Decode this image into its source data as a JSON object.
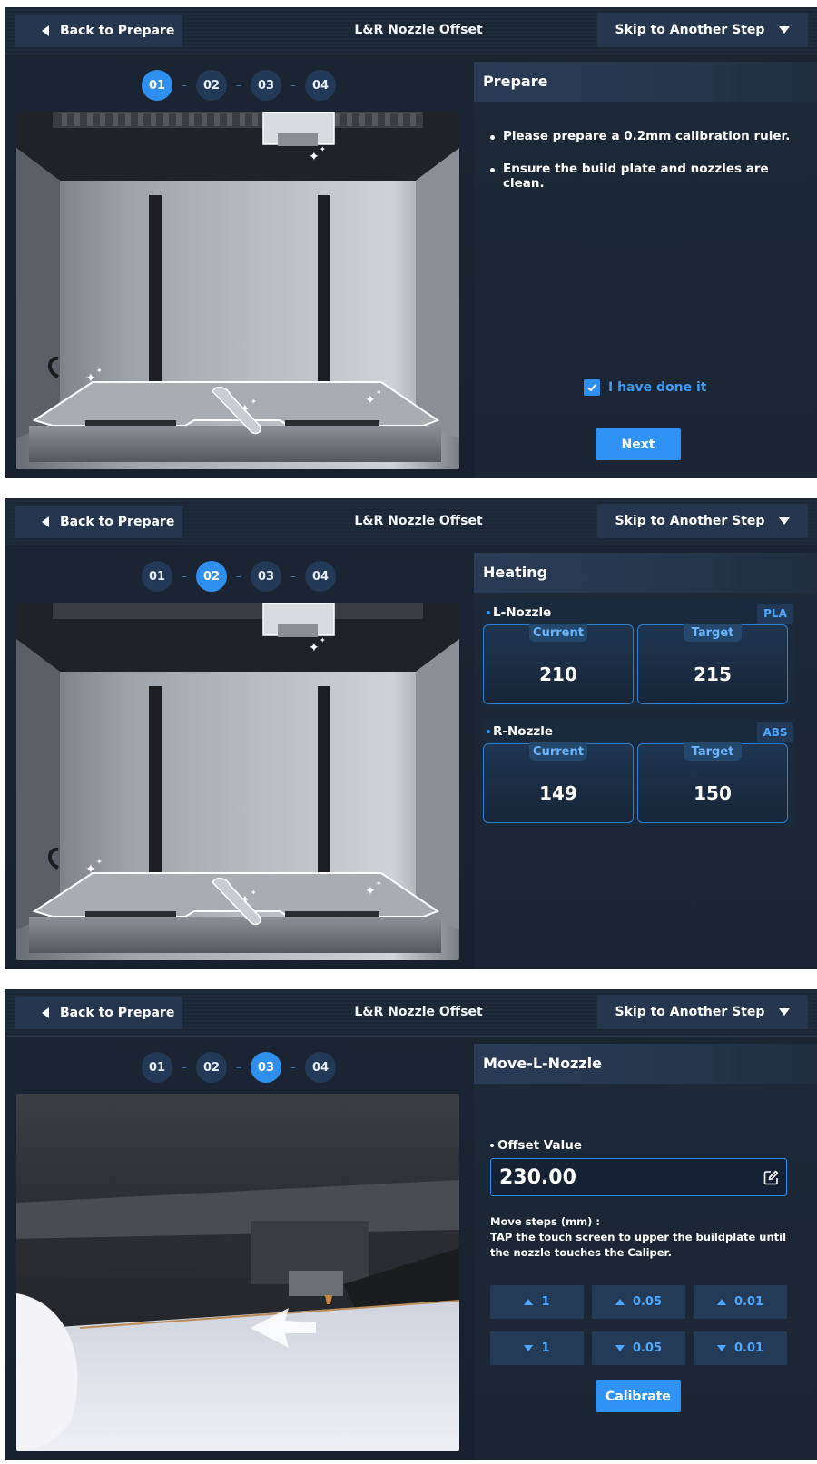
{
  "header": {
    "back_label": "Back to Prepare",
    "title": "L&R Nozzle Offset",
    "skip_label": "Skip to Another Step"
  },
  "steps": [
    "01",
    "02",
    "03",
    "04"
  ],
  "screens": [
    {
      "active_step": "01",
      "panel_title": "Prepare",
      "bullets": [
        "Please prepare a 0.2mm calibration ruler.",
        "Ensure the build plate and nozzles are clean."
      ],
      "checkbox_label": "I have done it",
      "checkbox_checked": true,
      "next_label": "Next"
    },
    {
      "active_step": "02",
      "panel_title": "Heating",
      "nozzles": [
        {
          "name": "L-Nozzle",
          "material": "PLA",
          "current_label": "Current",
          "current": "210",
          "target_label": "Target",
          "target": "215"
        },
        {
          "name": "R-Nozzle",
          "material": "ABS",
          "current_label": "Current",
          "current": "149",
          "target_label": "Target",
          "target": "150"
        }
      ]
    },
    {
      "active_step": "03",
      "panel_title": "Move-L-Nozzle",
      "offset_label": "Offset Value",
      "offset_value": "230.00",
      "move_steps_title": "Move steps (mm) :",
      "move_steps_hint": "TAP the touch screen to upper the buildplate until the nozzle touches the Caliper.",
      "up_buttons": [
        "1",
        "0.05",
        "0.01"
      ],
      "down_buttons": [
        "1",
        "0.05",
        "0.01"
      ],
      "calibrate_label": "Calibrate"
    }
  ],
  "icons": {
    "back": "caret-left-icon",
    "skip": "caret-down-icon",
    "check": "check-icon",
    "edit": "edit-icon",
    "up": "caret-up-icon",
    "down": "caret-down-icon"
  },
  "colors": {
    "accent": "#2f8fef",
    "background": "#1b2533",
    "button": "#24374f",
    "link": "#3d9cf5"
  }
}
